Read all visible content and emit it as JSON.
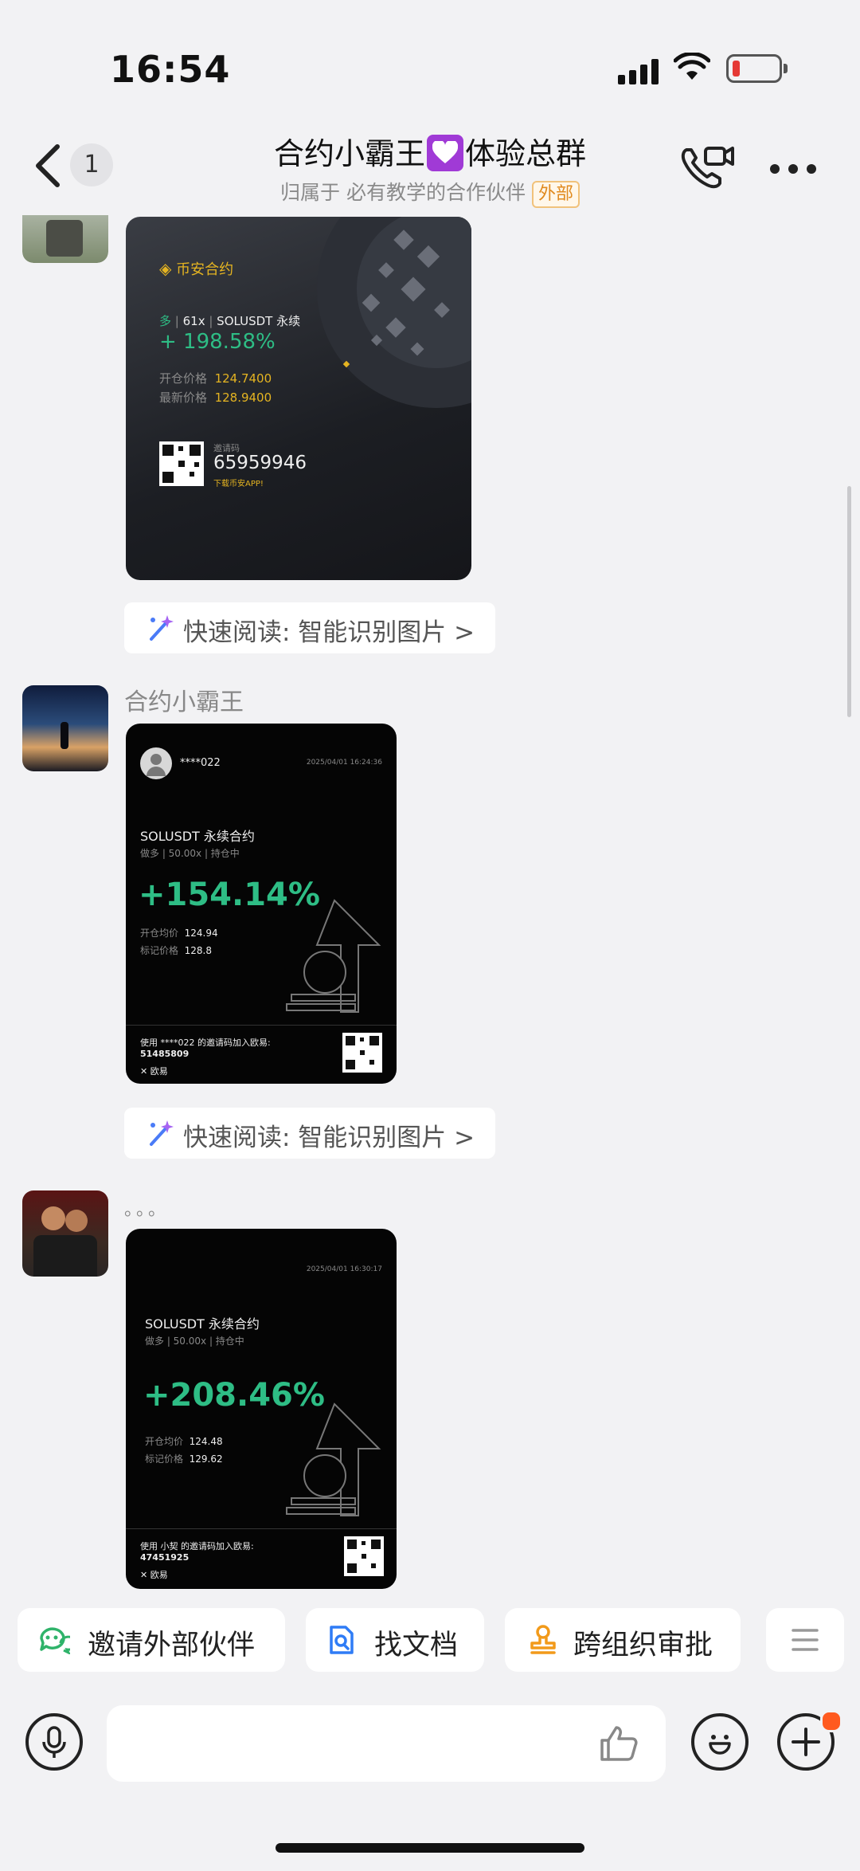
{
  "status_bar": {
    "time": "16:54"
  },
  "header": {
    "back_count": "1",
    "title_left": "合约小霸王",
    "title_right": "体验总群",
    "subtitle": "归属于 必有教学的合作伙伴",
    "external_tag": "外部"
  },
  "messages": [
    {
      "card": {
        "brand": "币安合约",
        "side": "多",
        "leverage": "61x",
        "symbol": "SOLUSDT 永续",
        "pnl": "+ 198.58%",
        "open_label": "开仓价格",
        "open_value": "124.7400",
        "latest_label": "最新价格",
        "latest_value": "128.9400",
        "invite_label": "邀请码",
        "invite_code": "65959946",
        "download": "下载币安APP!"
      },
      "read_chip": "快速阅读: 智能识别图片 >"
    },
    {
      "sender": "合约小霸王",
      "card": {
        "user": "****022",
        "timestamp": "2025/04/01 16:24:36",
        "symbol": "SOLUSDT 永续合约",
        "meta": "做多 | 50.00x | 持仓中",
        "pnl": "+154.14%",
        "open_label": "开仓均价",
        "open_value": "124.94",
        "mark_label": "标记价格",
        "mark_value": "128.8",
        "footer": "使用 ****022 的邀请码加入欧易:",
        "code": "51485809",
        "brand": "欧易"
      },
      "read_chip": "快速阅读: 智能识别图片 >"
    },
    {
      "sender": "。。。",
      "card": {
        "timestamp": "2025/04/01 16:30:17",
        "symbol": "SOLUSDT 永续合约",
        "meta": "做多 | 50.00x | 持仓中",
        "pnl": "+208.46%",
        "open_label": "开仓均价",
        "open_value": "124.48",
        "mark_label": "标记价格",
        "mark_value": "129.62",
        "footer": "使用 小契 的邀请码加入欧易:",
        "code": "47451925",
        "brand": "欧易"
      }
    }
  ],
  "quick_actions": [
    {
      "label": "邀请外部伙伴",
      "icon": "chat-invite-icon"
    },
    {
      "label": "找文档",
      "icon": "doc-search-icon"
    },
    {
      "label": "跨组织审批",
      "icon": "stamp-icon"
    }
  ],
  "colors": {
    "green": "#2ebd85",
    "gold": "#e5b421",
    "tag_orange": "#e08a1e"
  }
}
